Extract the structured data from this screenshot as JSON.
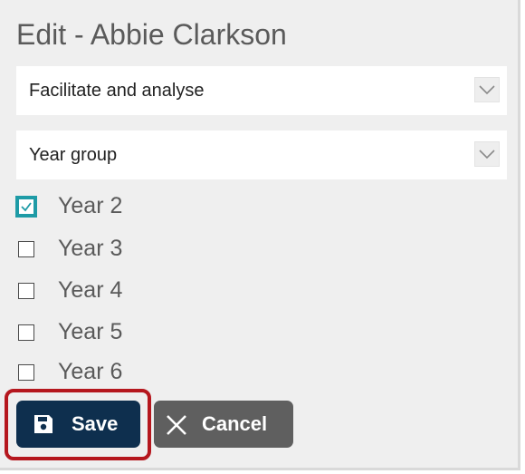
{
  "header": {
    "title": "Edit - Abbie Clarkson"
  },
  "selects": [
    {
      "value": "Facilitate and analyse",
      "icon": "chevron-down-icon"
    },
    {
      "value": "Year group",
      "icon": "chevron-down-icon"
    }
  ],
  "years": [
    {
      "label": "Year 2",
      "checked": true
    },
    {
      "label": "Year 3",
      "checked": false
    },
    {
      "label": "Year 4",
      "checked": false
    },
    {
      "label": "Year 5",
      "checked": false
    },
    {
      "label": "Year 6",
      "checked": false
    }
  ],
  "actions": {
    "save_label": "Save",
    "save_icon": "floppy-disk-icon",
    "cancel_label": "Cancel",
    "cancel_icon": "close-icon"
  },
  "colors": {
    "save_bg": "#0e2f4e",
    "cancel_bg": "#5f5f5f",
    "highlight": "#b5171e",
    "checkbox_accent": "#1e9ba6",
    "panel_bg": "#efefef"
  }
}
